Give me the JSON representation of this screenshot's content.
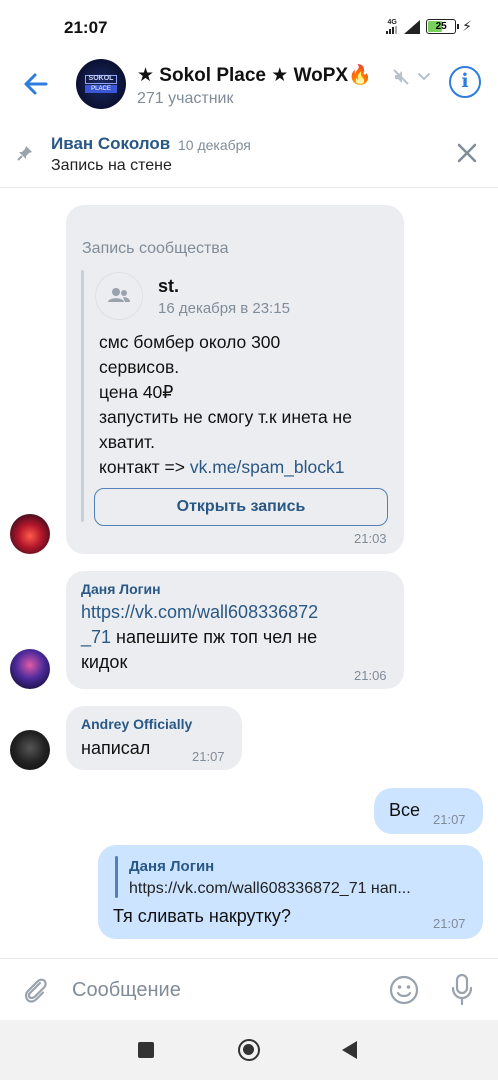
{
  "status_bar": {
    "time": "21:07",
    "network": "4G",
    "battery": "25"
  },
  "header": {
    "title": "★ Sokol Place ★ WoPX🔥",
    "subtitle": "271 участник",
    "avatar_logo_top": "SOKOL",
    "avatar_logo_bottom": "PLACE"
  },
  "pinned": {
    "author": "Иван Соколов",
    "date": "10 декабря",
    "text": "Запись на стене"
  },
  "messages": {
    "post": {
      "header": "Запись сообщества",
      "source_name": "st.",
      "source_date": "16 декабря в 23:15",
      "line1": "смс бомбер около 300",
      "line2": "сервисов.",
      "line3": "цена 40₽",
      "line4": "запустить не смогу т.к инета не",
      "line5": "хватит.",
      "line6_prefix": "контакт => ",
      "line6_link": "vk.me/spam_block1",
      "open_button": "Открыть запись",
      "time": "21:03"
    },
    "msg2": {
      "author": "Даня Логин",
      "link_part1": "https://vk.com/wall608336872",
      "link_part2": "_71",
      "text_after_link": " напешите пж топ чел не",
      "text_line3": "кидок",
      "time": "21:06"
    },
    "msg3": {
      "author": "Andrey Officially",
      "text": "написал",
      "time": "21:07"
    },
    "out1": {
      "text": "Все",
      "time": "21:07"
    },
    "out2": {
      "reply_author": "Даня Логин",
      "reply_text": "https://vk.com/wall608336872_71 нап...",
      "text": "Тя сливать накрутку?",
      "time": "21:07"
    }
  },
  "input": {
    "placeholder": "Сообщение"
  },
  "colors": {
    "accent": "#2c7de0",
    "link": "#2a5885",
    "incoming": "#ebedf0",
    "outgoing": "#cce4ff"
  }
}
